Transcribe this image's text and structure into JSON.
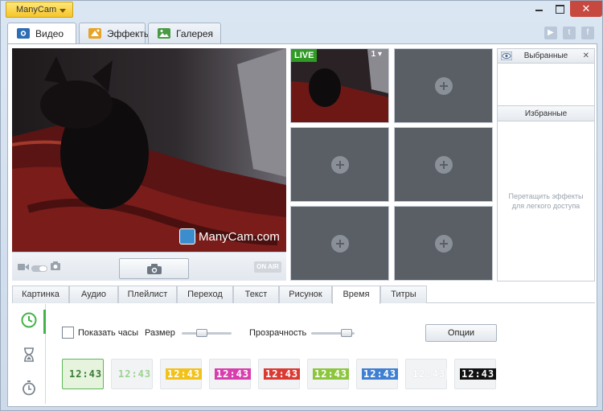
{
  "app": {
    "menu_label": "ManyCam",
    "close_glyph": "✕"
  },
  "main_tabs": [
    {
      "label": "Видео",
      "icon": "video-tab-icon"
    },
    {
      "label": "Эффекты",
      "icon": "effects-tab-icon"
    },
    {
      "label": "Галерея",
      "icon": "gallery-tab-icon"
    }
  ],
  "social": [
    {
      "name": "youtube-icon",
      "glyph": "▶"
    },
    {
      "name": "twitter-icon",
      "glyph": "t"
    },
    {
      "name": "facebook-icon",
      "glyph": "f"
    }
  ],
  "preview": {
    "watermark": "ManyCam.com",
    "onair": "ON AIR"
  },
  "sources": {
    "live_label": "LIVE",
    "source_number": "1"
  },
  "favorites": {
    "header_top": "Выбранные",
    "header_bottom": "Избранные",
    "hint": "Перетащить эффекты для легкого доступа"
  },
  "sub_tabs": [
    "Картинка",
    "Аудио",
    "Плейлист",
    "Переход",
    "Текст",
    "Рисунок",
    "Время",
    "Титры"
  ],
  "clock": {
    "show_clock_label": "Показать часы",
    "size_label": "Размер",
    "opacity_label": "Прозрачность",
    "options_label": "Опции",
    "show_clock_checked": false
  },
  "clock_styles": [
    {
      "text": "12:43",
      "color": "#3a7a35",
      "bg": "#e6f3dd"
    },
    {
      "text": "12:43",
      "color": "#9bd38f",
      "bg": "#f1f3f5"
    },
    {
      "text": "12:43",
      "color": "#ffffff",
      "bg": "#f2c21b"
    },
    {
      "text": "12:43",
      "color": "#ffffff",
      "bg": "#d83fae"
    },
    {
      "text": "12:43",
      "color": "#ffffff",
      "bg": "#d93a33"
    },
    {
      "text": "12:43",
      "color": "#ffffff",
      "bg": "#8cc63f"
    },
    {
      "text": "12:43",
      "color": "#ffffff",
      "bg": "#3f7fd1"
    },
    {
      "text": "12:43",
      "color": "#ffffff",
      "bg": "#f1f3f5"
    },
    {
      "text": "12:43",
      "color": "#ffffff",
      "bg": "#111111"
    }
  ]
}
